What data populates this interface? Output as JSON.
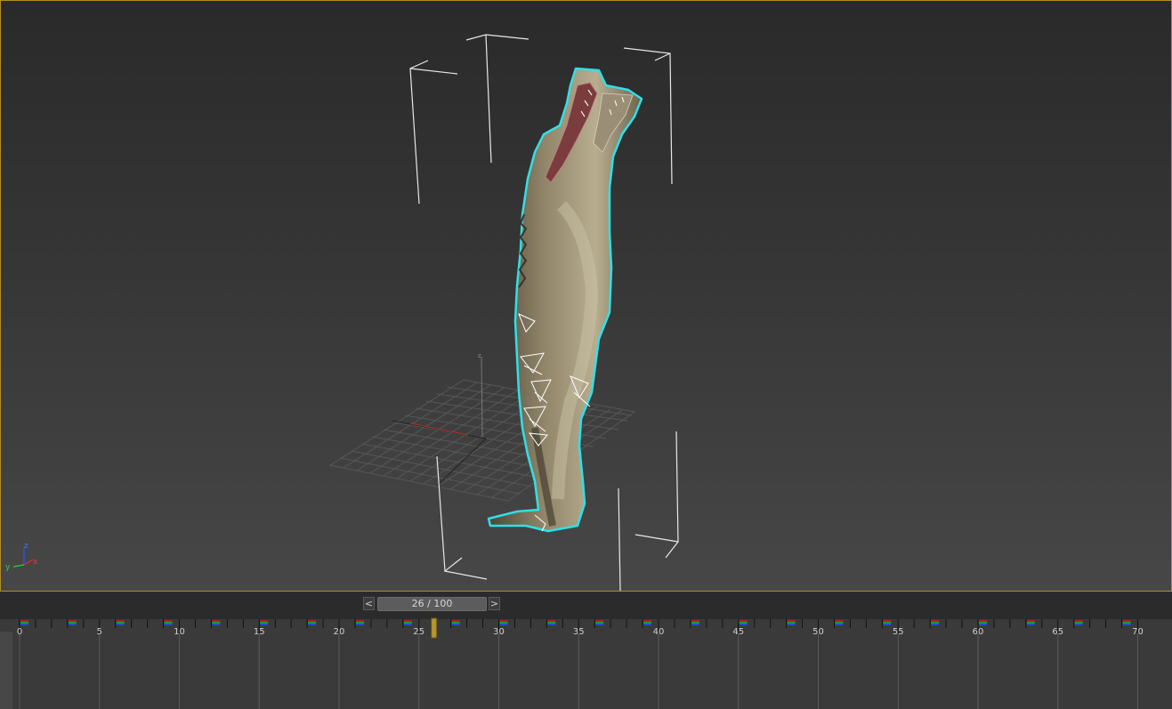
{
  "viewport": {
    "axis_labels": {
      "x": "x",
      "y": "y",
      "z": "z"
    }
  },
  "time_slider": {
    "prev_label": "<",
    "next_label": ">",
    "position_text": "26 / 100",
    "current_frame": 26,
    "total_frames": 100
  },
  "track_bar": {
    "frame_labels": [
      "0",
      "5",
      "10",
      "15",
      "20",
      "25",
      "30",
      "35",
      "40",
      "45",
      "50",
      "55",
      "60",
      "65",
      "70"
    ],
    "current_frame_marker": 26,
    "colors": {
      "key_red": "#b02020",
      "key_green": "#20a020",
      "key_blue": "#2050c0",
      "current_marker": "#b8962e"
    }
  },
  "colors": {
    "viewport_border": "#b48c28",
    "selection_outline": "#2fe0e8"
  }
}
